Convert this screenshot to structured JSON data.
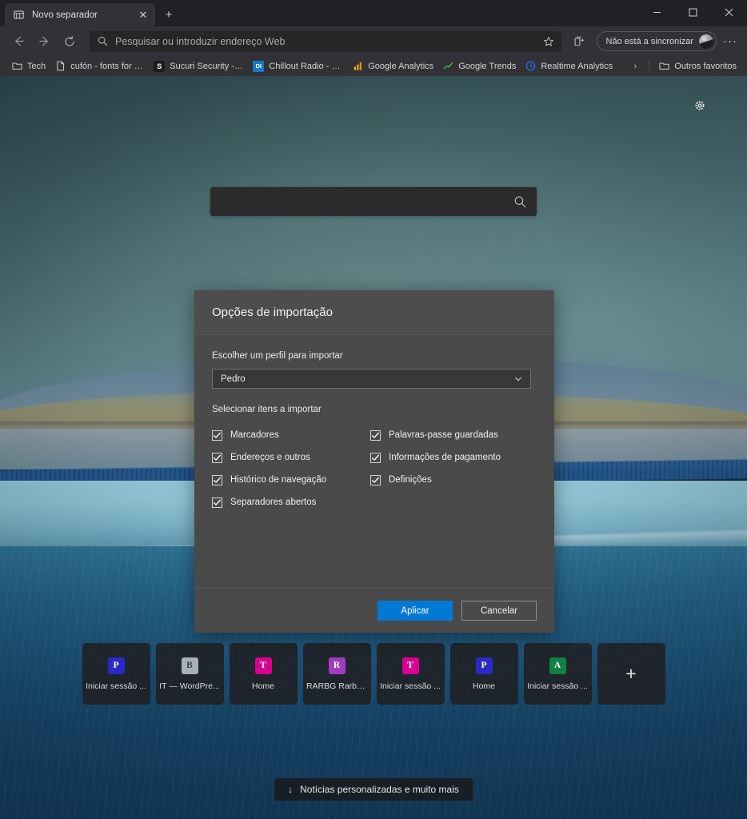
{
  "window": {
    "controls": {
      "minimize": "—",
      "maximize": "▢",
      "close": "✕"
    }
  },
  "tabs": [
    {
      "title": "Novo separador",
      "favicon": "newtab-icon",
      "close_label": "✕"
    }
  ],
  "newtab_button": {
    "label": "+"
  },
  "toolbar": {
    "back_label": "←",
    "forward_label": "→",
    "refresh_label": "↻",
    "omnibox": {
      "placeholder": "Pesquisar ou introduzir endereço Web",
      "value": ""
    },
    "favorite_label": "☆",
    "collections_label": "collections-icon",
    "profile": {
      "label": "Não está a sincronizar"
    },
    "settings_more_label": "···"
  },
  "favorites": {
    "items": [
      {
        "label": "Tech",
        "icon_type": "folder",
        "icon_text": "",
        "icon_color": ""
      },
      {
        "label": "cufón - fonts for th...",
        "icon_type": "page",
        "icon_text": "",
        "icon_color": ""
      },
      {
        "label": "Sucuri Security - Pr...",
        "icon_type": "square",
        "icon_text": "S",
        "icon_color": "#1d1d1d"
      },
      {
        "label": "Chillout Radio - Dig...",
        "icon_type": "square",
        "icon_text": "DI",
        "icon_color": "#1878c8"
      },
      {
        "label": "Google Analytics",
        "icon_type": "bars",
        "icon_text": "",
        "icon_color": "#f9ab00"
      },
      {
        "label": "Google Trends",
        "icon_type": "trend",
        "icon_text": "",
        "icon_color": "#4caf50"
      },
      {
        "label": "Realtime Analytics",
        "icon_type": "clock",
        "icon_text": "",
        "icon_color": "#1a73e8"
      }
    ],
    "overflow_label": "›",
    "other_folder": {
      "label": "Outros favoritos",
      "icon_type": "folder"
    }
  },
  "newtab": {
    "settings_gear_label": "gear-icon",
    "search": {
      "value": "",
      "placeholder": "",
      "icon": "search-icon"
    },
    "tiles": [
      {
        "label": "Iniciar sessão ...",
        "initial": "P",
        "color": "#2929c7"
      },
      {
        "label": "IT — WordPre...",
        "initial": "B",
        "color": "#a9b0bb"
      },
      {
        "label": "Home",
        "initial": "T",
        "color": "#d60091"
      },
      {
        "label": "RARBG Rarbg...",
        "initial": "R",
        "color": "#a03cc0"
      },
      {
        "label": "Iniciar sessão ...",
        "initial": "T",
        "color": "#d60091"
      },
      {
        "label": "Home",
        "initial": "P",
        "color": "#2929c7"
      },
      {
        "label": "Iniciar sessão ...",
        "initial": "A",
        "color": "#0f8043"
      }
    ],
    "add_tile": {
      "label": "+"
    },
    "news_pill": {
      "arrow": "↓",
      "label": "Notícias personalizadas e muito mais"
    }
  },
  "dialog": {
    "title": "Opções de importação",
    "profile_label": "Escolher um perfil para importar",
    "profile_value": "Pedro",
    "profile_chevron": "chevron-down-icon",
    "items_label": "Selecionar itens a importar",
    "checkboxes": [
      {
        "label": "Marcadores",
        "checked": true
      },
      {
        "label": "Endereços e outros",
        "checked": true
      },
      {
        "label": "Histórico de navegação",
        "checked": true
      },
      {
        "label": "Separadores abertos",
        "checked": true
      },
      {
        "label": "Palavras-passe guardadas",
        "checked": true
      },
      {
        "label": "Informações de pagamento",
        "checked": true
      },
      {
        "label": "Definições",
        "checked": true
      },
      {
        "label": "",
        "checked": false
      }
    ],
    "apply_label": "Aplicar",
    "cancel_label": "Cancelar",
    "accent_color": "#0078d4"
  }
}
